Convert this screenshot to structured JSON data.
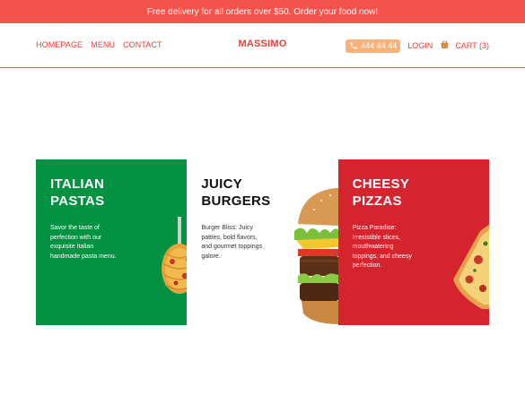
{
  "promo": {
    "text": "Free delivery for all orders over $50. Order your food now!"
  },
  "header": {
    "nav": [
      {
        "label": "HOMEPAGE"
      },
      {
        "label": "MENU"
      },
      {
        "label": "CONTACT"
      }
    ],
    "brand": "MASSIMO",
    "phone": "444 44 44",
    "login_label": "LOGIN",
    "cart_label": "CART (3)"
  },
  "cards": [
    {
      "title_line1": "ITALIAN",
      "title_line2": "PASTAS",
      "description": "Savor the taste of perfection with our exquisite Italian handmade pasta menu.",
      "background": "#039241",
      "image": "pasta-fork-image"
    },
    {
      "title_line1": "JUICY",
      "title_line2": "BURGERS",
      "description": "Burger Bliss: Juicy patties, bold flavors, and gourmet toppings galore.",
      "background": "#ffffff",
      "image": "burger-image"
    },
    {
      "title_line1": "CHEESY",
      "title_line2": "PIZZAS",
      "description": "Pizza Paradise: Irresistible slices, mouthwatering toppings, and cheesy perfection.",
      "background": "#d4252f",
      "image": "pizza-slice-image"
    }
  ],
  "colors": {
    "accent": "#f4524d",
    "brand_text": "#e8403c",
    "phone_pill": "#f9b27a",
    "green": "#039241",
    "red": "#d4252f"
  }
}
